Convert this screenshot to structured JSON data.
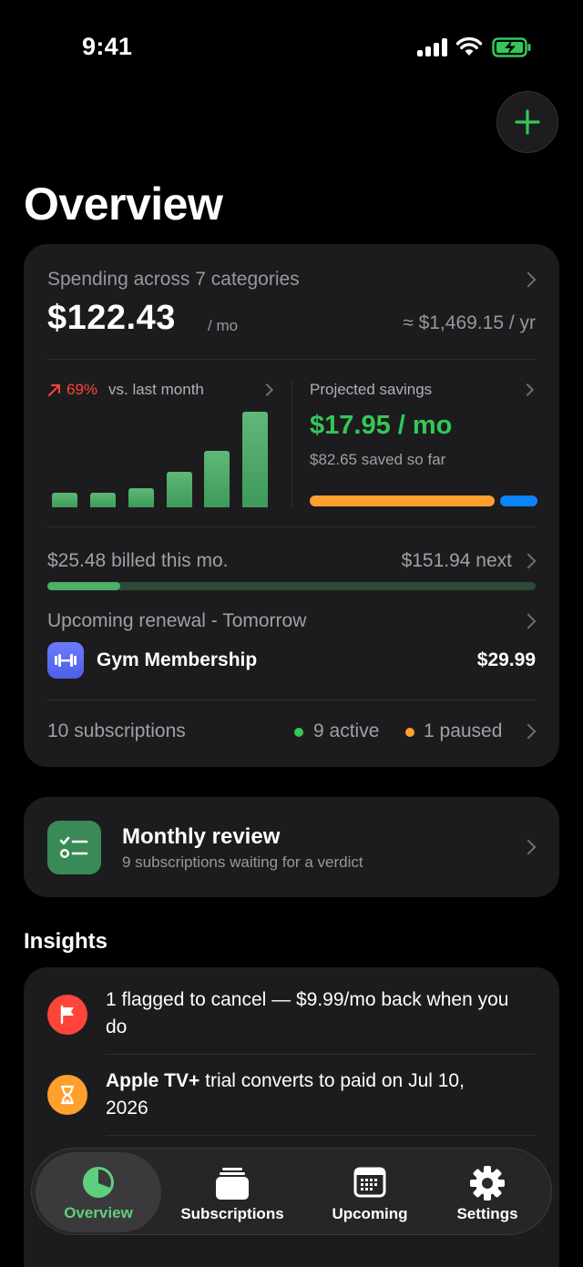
{
  "status_bar": {
    "time": "9:41"
  },
  "header": {
    "title": "Overview"
  },
  "summary": {
    "spending_label": "Spending across 7 categories",
    "monthly_amount": "$122.43",
    "monthly_unit": "/ mo",
    "yearly_amount": "≈ $1,469.15 / yr",
    "trend_percent": "69%",
    "trend_label": "vs. last month",
    "bar_chart_values": [
      0.15,
      0.15,
      0.2,
      0.37,
      0.59,
      1.0
    ],
    "savings_label": "Projected savings",
    "savings_amount": "$17.95 / mo",
    "savings_saved": "$82.65 saved so far",
    "savings_progress": 0.82,
    "billed_label": "$25.48 billed this mo.",
    "next_label": "$151.94 next",
    "billed_progress": 0.15,
    "renewal_label": "Upcoming renewal - Tomorrow",
    "renewal_name": "Gym Membership",
    "renewal_price": "$29.99",
    "subscriptions_count": "10 subscriptions",
    "active_label": "9 active",
    "paused_label": "1 paused"
  },
  "review": {
    "title": "Monthly review",
    "subtitle": "9 subscriptions waiting for a verdict"
  },
  "insights": {
    "heading": "Insights",
    "items": [
      {
        "text": "1 flagged to cancel — $9.99/mo back when you do"
      },
      {
        "bold": "Apple TV+",
        "text": " trial converts to paid on Jul 10, 2026"
      }
    ]
  },
  "tabs": [
    {
      "label": "Overview",
      "icon": "pie-chart-icon"
    },
    {
      "label": "Subscriptions",
      "icon": "stack-icon"
    },
    {
      "label": "Upcoming",
      "icon": "calendar-icon"
    },
    {
      "label": "Settings",
      "icon": "gear-icon"
    }
  ],
  "colors": {
    "accent_green": "#34c759",
    "red": "#ff453a",
    "orange": "#ff9f2e",
    "blue": "#0a84ff",
    "card": "#1c1c1e"
  }
}
